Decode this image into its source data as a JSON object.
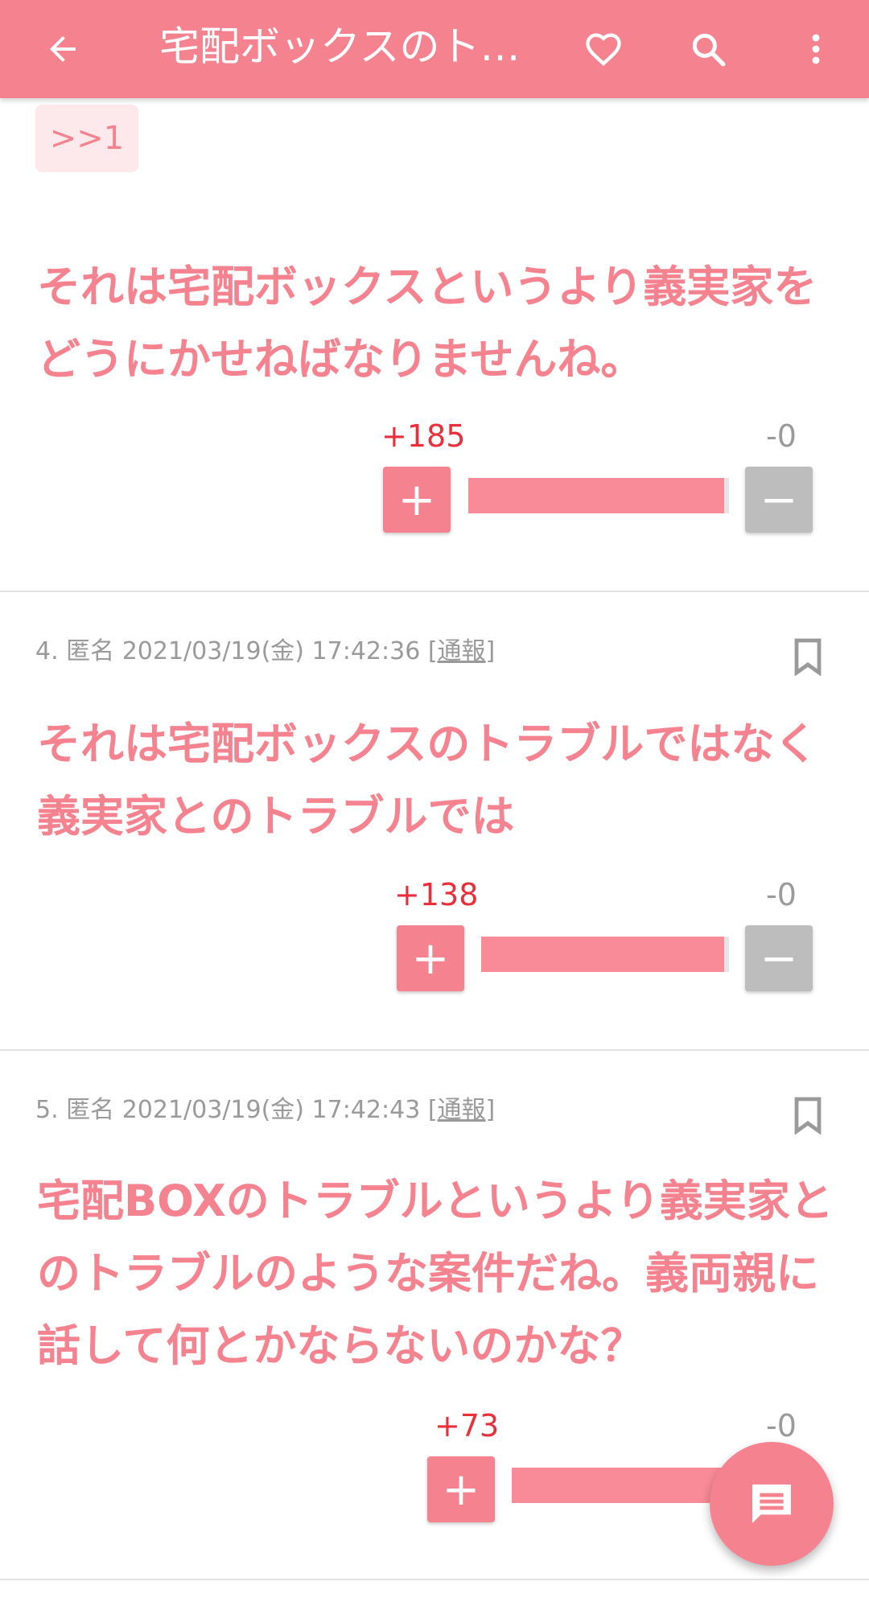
{
  "appbar": {
    "title": "宅配ボックスのト…",
    "icons": [
      "arrow-left-icon",
      "heart-icon",
      "search-icon",
      "more-vert-icon"
    ]
  },
  "colors": {
    "accent": "#f5838f",
    "plus_count": "#e8303c",
    "minus_button": "#bdbdbd"
  },
  "comments": [
    {
      "anchor": ">>1",
      "body_lines": [
        "それは宅配ボックスというより義実家を",
        "どうにかせねばなりませんね。"
      ],
      "plus": "+185",
      "minus": "-0"
    },
    {
      "meta": "4. 匿名 2021/03/19(金) 17:42:36 [",
      "report": "通報",
      "meta_end": "]",
      "body_lines": [
        "それは宅配ボックスのトラブルではなく",
        "義実家とのトラブルでは"
      ],
      "plus": "+138",
      "minus": "-0"
    },
    {
      "meta": "5. 匿名 2021/03/19(金) 17:42:43 [",
      "report": "通報",
      "meta_end": "]",
      "body_lines": [
        "宅配BOXのトラブルというより義実家と",
        "のトラブルのような案件だね。義両親に",
        "話して何とかならないのかな？"
      ],
      "plus": "+73",
      "minus": "-0"
    }
  ],
  "buttons": {
    "plus": "+",
    "minus": "−"
  },
  "fab_icon": "comment-icon"
}
